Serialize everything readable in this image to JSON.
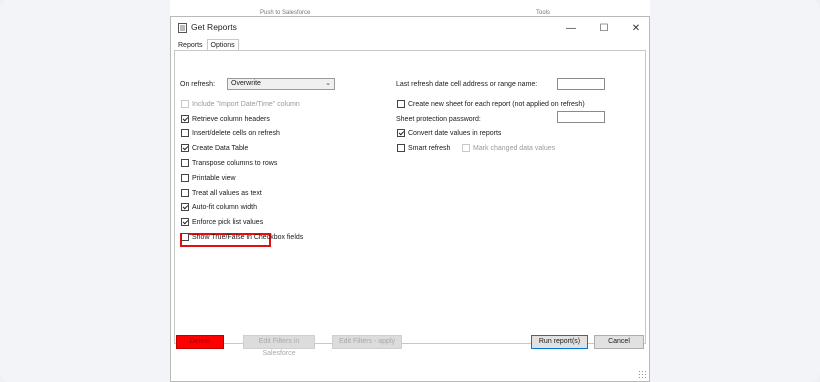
{
  "background_window": {
    "left_text": "Push to Salesforce",
    "right_text": "Tools"
  },
  "window": {
    "title": "Get Reports",
    "controls": {
      "minimize": "—",
      "maximize": "☐",
      "close": "✕"
    }
  },
  "tabs": [
    {
      "label": "Reports",
      "active": false
    },
    {
      "label": "Options",
      "active": true
    }
  ],
  "left": {
    "on_refresh_label": "On refresh:",
    "on_refresh_value": "Overwrite",
    "options": [
      {
        "label": "Include \"Import Date/Time\" column",
        "checked": false,
        "disabled": true
      },
      {
        "label": "Retrieve column headers",
        "checked": true,
        "disabled": false
      },
      {
        "label": "Insert/delete cells on refresh",
        "checked": false,
        "disabled": false
      },
      {
        "label": "Create Data Table",
        "checked": true,
        "disabled": false
      },
      {
        "label": "Transpose columns to rows",
        "checked": false,
        "disabled": false
      },
      {
        "label": "Printable view",
        "checked": false,
        "disabled": false
      },
      {
        "label": "Treat all values as text",
        "checked": false,
        "disabled": false
      },
      {
        "label": "Auto-fit column width",
        "checked": true,
        "disabled": false
      },
      {
        "label": "Enforce pick list values",
        "checked": true,
        "disabled": false
      },
      {
        "label": "Show True/False in Checkbox fields",
        "checked": false,
        "disabled": false
      }
    ]
  },
  "right": {
    "last_refresh_label": "Last refresh date cell address or range name:",
    "last_refresh_value": "",
    "new_sheet_label": "Create new sheet for each report (not applied on refresh)",
    "new_sheet_checked": false,
    "sheet_password_label": "Sheet protection password:",
    "sheet_password_value": "",
    "convert_dates_label": "Convert date values in reports",
    "convert_dates_checked": true,
    "smart_refresh_label": "Smart refresh",
    "smart_refresh_checked": false,
    "mark_changed_label": "Mark changed data values",
    "mark_changed_checked": false
  },
  "buttons": {
    "delete": "Delete",
    "edit_salesforce": "Edit Filters in Salesforce",
    "edit_apply": "Edit Filters - apply",
    "run": "Run report(s)",
    "cancel": "Cancel"
  },
  "colors": {
    "highlight": "#e01010",
    "delete_button": "#ff0000",
    "primary_border": "#0078d7"
  }
}
